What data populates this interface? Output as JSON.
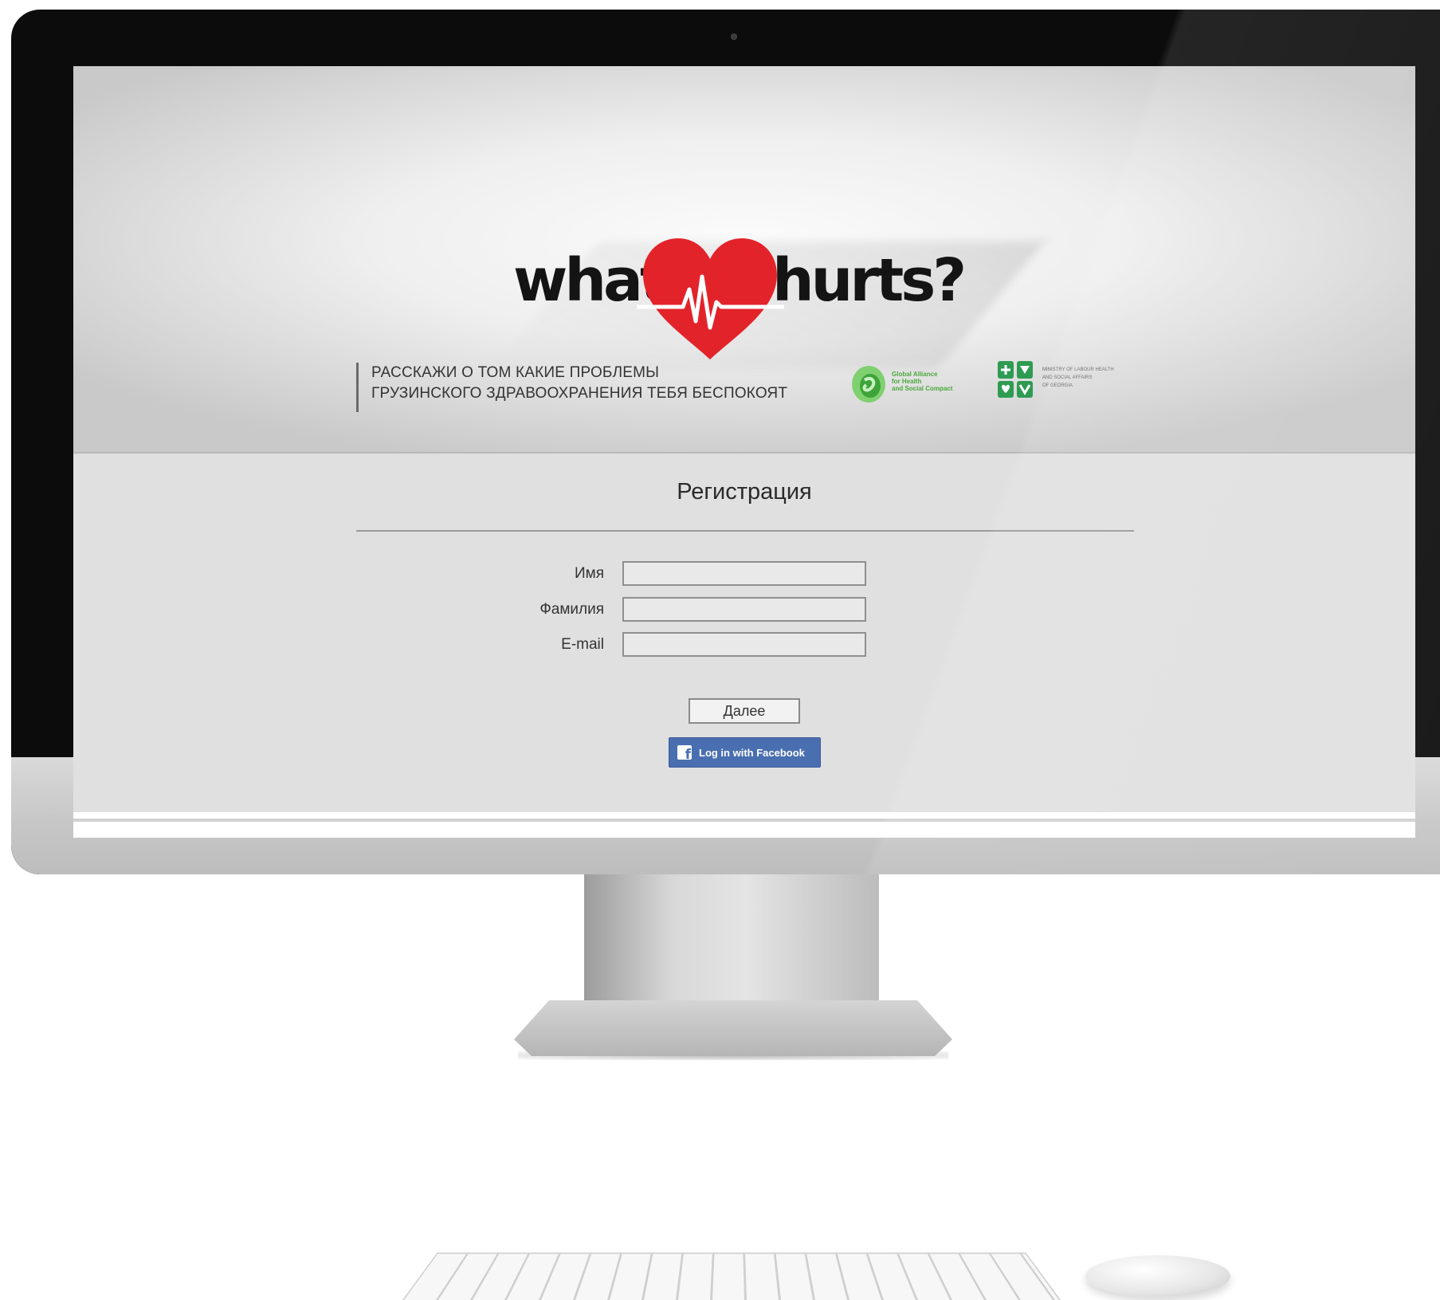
{
  "logo": {
    "word_left": "what",
    "word_right": "hurts?",
    "heart_color": "#e3232a"
  },
  "tagline": {
    "line1": "РАССКАЖИ О ТОМ КАКИЕ ПРОБЛЕМЫ",
    "line2": "ГРУЗИНСКОГО ЗДРАВООХРАНЕНИЯ ТЕБЯ БЕСПОКОЯТ"
  },
  "partners": {
    "alliance": [
      "Global Alliance",
      "for Health",
      "and Social Compact"
    ],
    "ministry": [
      "MINISTRY OF LABOUR HEALTH",
      "AND SOCIAL AFFAIRS",
      "OF GEORGIA"
    ],
    "alliance_color": "#4aa83c",
    "ministry_color": "#2e9b52"
  },
  "form": {
    "title": "Регистрация",
    "first_name_label": "Имя",
    "first_name_value": "",
    "last_name_label": "Фамилия",
    "last_name_value": "",
    "email_label": "E-mail",
    "email_value": "",
    "next_button": "Далее",
    "facebook_button": "Log in with Facebook",
    "facebook_color": "#4a6fb0"
  }
}
